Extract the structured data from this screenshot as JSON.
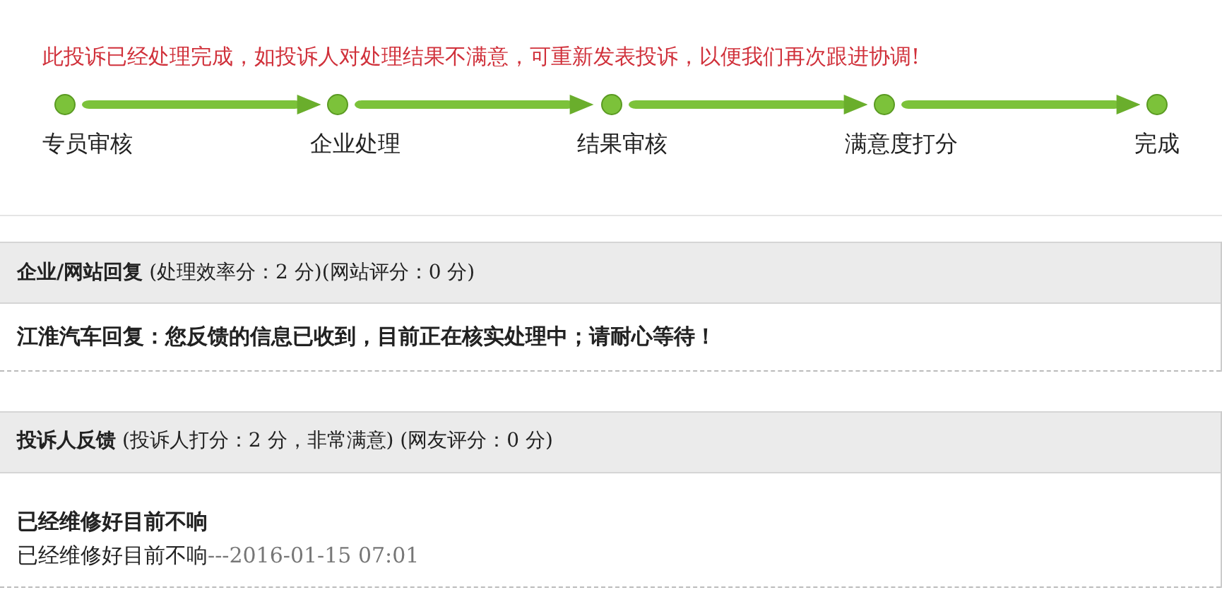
{
  "notice": "此投诉已经处理完成，如投诉人对处理结果不满意，可重新发表投诉，以便我们再次跟进协调!",
  "steps": [
    {
      "label": "专员审核"
    },
    {
      "label": "企业处理"
    },
    {
      "label": "结果审核"
    },
    {
      "label": "满意度打分"
    },
    {
      "label": "完成"
    }
  ],
  "sections": [
    {
      "header": "**企业/网站回复** (处理效率分：2 分)(网站评分：0 分)",
      "lines": [
        {
          "kind": "reply",
          "text": "江淮汽车回复：您反馈的信息已收到，目前正在核实处理中；请耐心等待！"
        }
      ]
    },
    {
      "header": "**投诉人反馈** (投诉人打分：2 分，非常满意) (网友评分：0 分)",
      "lines": [
        {
          "kind": "title",
          "text": "已经维修好目前不响"
        },
        {
          "kind": "entry",
          "text": "已经维修好目前不响",
          "time": "---2016-01-15 07:01"
        }
      ]
    }
  ]
}
